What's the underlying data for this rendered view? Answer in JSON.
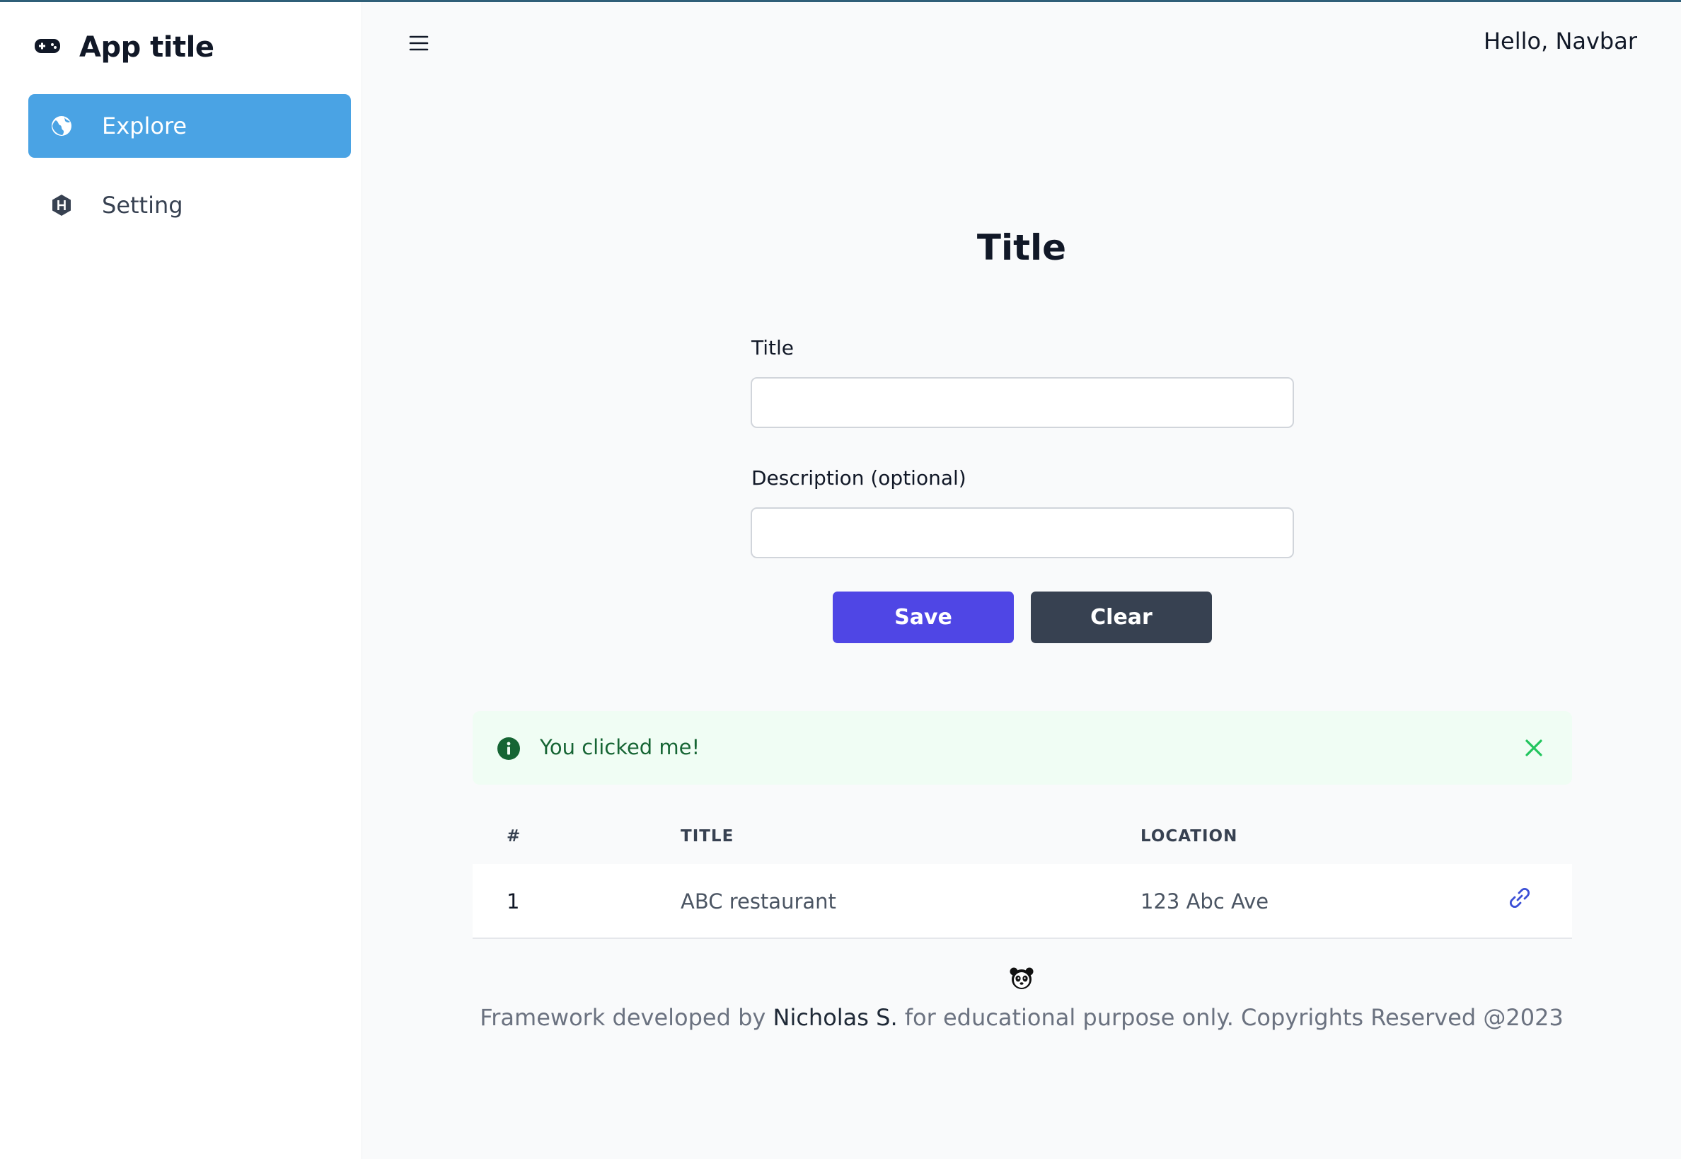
{
  "app": {
    "title": "App title"
  },
  "sidebar": {
    "items": [
      {
        "label": "Explore",
        "icon": "globe-icon",
        "active": true
      },
      {
        "label": "Setting",
        "icon": "hexagon-h-icon",
        "active": false
      }
    ]
  },
  "header": {
    "greeting": "Hello, Navbar",
    "menu_icon": "hamburger-icon"
  },
  "form": {
    "title": "Title",
    "fields": [
      {
        "label": "Title",
        "value": "",
        "placeholder": ""
      },
      {
        "label": "Description (optional)",
        "value": "",
        "placeholder": ""
      }
    ],
    "save_label": "Save",
    "clear_label": "Clear"
  },
  "alert": {
    "message": "You clicked me!",
    "icon": "info-icon",
    "close_icon": "close-icon"
  },
  "table": {
    "headers": [
      "#",
      "TITLE",
      "LOCATION"
    ],
    "rows": [
      {
        "num": "1",
        "title": "ABC restaurant",
        "location": "123 Abc Ave",
        "action_icon": "link-icon"
      }
    ]
  },
  "footer": {
    "prefix": "Framework developed by",
    "author": "Nicholas S.",
    "suffix": "for educational purpose only. Copyrights Reserved @2023",
    "logo_icon": "panda-icon"
  },
  "colors": {
    "accent": "#4aa3e4",
    "primary_button": "#4f46e5",
    "secondary_button": "#374151",
    "alert_bg": "#f0fdf4",
    "alert_text": "#166534"
  }
}
